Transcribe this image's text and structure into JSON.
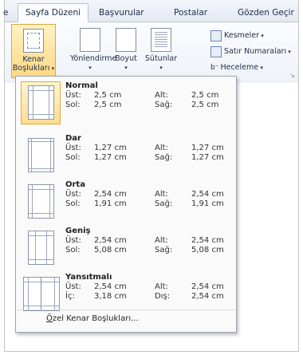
{
  "tabs": [
    "e",
    "Sayfa Düzeni",
    "Başvurular",
    "Postalar",
    "Gözden Geçir"
  ],
  "ribbon": {
    "margins": "Kenar Boşlukları",
    "margins_l1": "Kenar",
    "margins_l2": "Boşlukları",
    "orientation": "Yönlendirme",
    "size": "Boyut",
    "columns": "Sütunlar",
    "breaks": "Kesmeler",
    "line_numbers": "Satır Numaraları",
    "hyphenation": "Heceleme",
    "hyphen_prefix": "b⁻"
  },
  "menu": {
    "items": [
      {
        "name": "Normal",
        "l1": "Üst:",
        "v1": "2,5 cm",
        "r1": "Alt:",
        "w1": "2,5 cm",
        "l2": "Sol:",
        "v2": "2,5 cm",
        "r2": "Sağ:",
        "w2": "2,5 cm"
      },
      {
        "name": "Dar",
        "l1": "Üst:",
        "v1": "1,27 cm",
        "r1": "Alt:",
        "w1": "1,27 cm",
        "l2": "Sol:",
        "v2": "1,27 cm",
        "r2": "Sağ:",
        "w2": "1,27 cm"
      },
      {
        "name": "Orta",
        "l1": "Üst:",
        "v1": "2,54 cm",
        "r1": "Alt:",
        "w1": "2,54 cm",
        "l2": "Sol:",
        "v2": "1,91 cm",
        "r2": "Sağ:",
        "w2": "1,91 cm"
      },
      {
        "name": "Geniş",
        "l1": "Üst:",
        "v1": "2,54 cm",
        "r1": "Alt:",
        "w1": "2,54 cm",
        "l2": "Sol:",
        "v2": "5,08 cm",
        "r2": "Sağ:",
        "w2": "5,08 cm"
      },
      {
        "name": "Yansıtmalı",
        "l1": "Üst:",
        "v1": "2,54 cm",
        "r1": "Alt:",
        "w1": "2,54 cm",
        "l2": "İç:",
        "v2": "3,18 cm",
        "r2": "Dış:",
        "w2": "2,54 cm"
      }
    ],
    "custom_accel": "Ö",
    "custom_rest": "zel Kenar Boşlukları..."
  },
  "colors": {
    "highlight": "#ffd884",
    "ribbon_text": "#1d2d49"
  },
  "icons": [
    "margins-icon",
    "orientation-icon",
    "size-icon",
    "columns-icon",
    "breaks-icon",
    "line-numbers-icon",
    "hyphenation-icon",
    "dialog-launcher-icon"
  ]
}
